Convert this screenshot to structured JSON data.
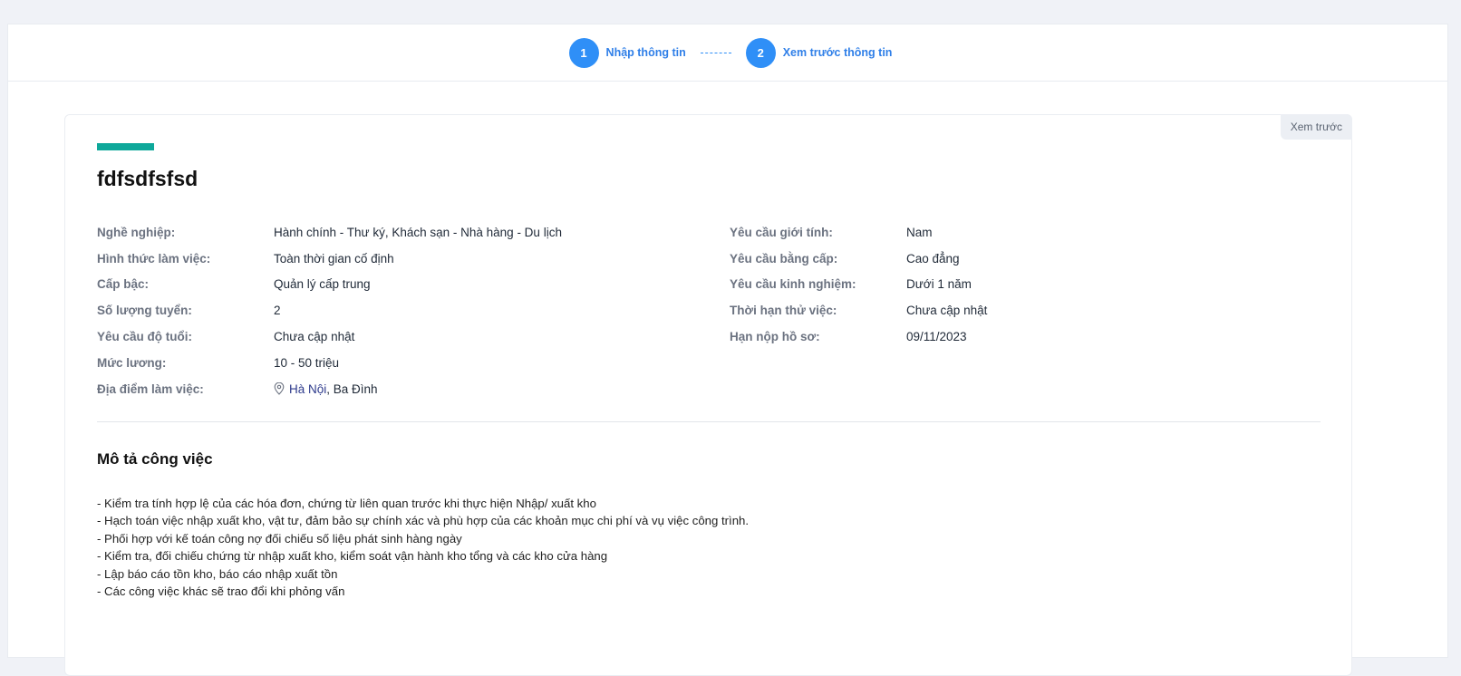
{
  "stepper": {
    "steps": [
      {
        "number": "1",
        "label": "Nhập thông tin"
      },
      {
        "number": "2",
        "label": "Xem trước thông tin"
      }
    ]
  },
  "card": {
    "preview_tag": "Xem trước",
    "title": "fdfsdfsfsd",
    "left_info": [
      {
        "label": "Nghề nghiệp:",
        "value": "Hành chính - Thư ký, Khách sạn - Nhà hàng - Du lịch"
      },
      {
        "label": "Hình thức làm việc:",
        "value": "Toàn thời gian cố định"
      },
      {
        "label": "Cấp bậc:",
        "value": "Quản lý cấp trung"
      },
      {
        "label": "Số lượng tuyển:",
        "value": "2"
      },
      {
        "label": "Yêu cầu độ tuổi:",
        "value": "Chưa cập nhật"
      },
      {
        "label": "Mức lương:",
        "value": "10 - 50 triệu"
      }
    ],
    "location": {
      "label": "Địa điểm làm việc:",
      "city": "Hà Nội",
      "district": ", Ba Đình"
    },
    "right_info": [
      {
        "label": "Yêu cầu giới tính:",
        "value": "Nam"
      },
      {
        "label": "Yêu cầu bằng cấp:",
        "value": "Cao đẳng"
      },
      {
        "label": "Yêu cầu kinh nghiệm:",
        "value": "Dưới 1 năm"
      },
      {
        "label": "Thời hạn thử việc:",
        "value": "Chưa cập nhật"
      },
      {
        "label": "Hạn nộp hồ sơ:",
        "value": "09/11/2023"
      }
    ],
    "description_title": "Mô tả công việc",
    "description_lines": [
      "- Kiểm tra tính hợp lệ của các hóa đơn, chứng từ liên quan trước khi thực hiện Nhập/ xuất kho",
      "- Hạch toán việc nhập xuất kho, vật tư, đảm bảo sự chính xác và phù hợp của các khoản mục chi phí và vụ việc công trình.",
      "- Phối hợp với kế toán công nợ đối chiếu số liệu phát sinh hàng ngày",
      "- Kiểm tra, đối chiếu chứng từ nhập xuất kho, kiểm soát vận hành kho tổng và các kho cửa hàng",
      "- Lập báo cáo tồn kho, báo cáo nhập xuất tồn",
      "- Các công việc khác sẽ trao đổi khi phỏng vấn"
    ]
  },
  "colors": {
    "accent": "#0ea89a",
    "step": "#2f8ff7",
    "link": "#2d3a8c"
  },
  "icons": {
    "location": "map-pin-icon"
  }
}
